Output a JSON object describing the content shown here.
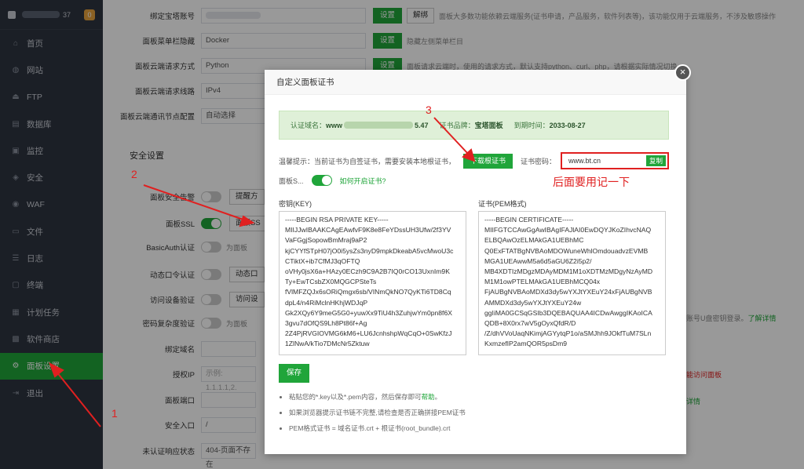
{
  "sidebar": {
    "account_suffix": "37",
    "badge": "0",
    "items": [
      {
        "label": "首页",
        "icon": "home-icon",
        "glyph": "⌂"
      },
      {
        "label": "网站",
        "icon": "globe-icon",
        "glyph": "◍"
      },
      {
        "label": "FTP",
        "icon": "ftp-icon",
        "glyph": "⏏"
      },
      {
        "label": "数据库",
        "icon": "database-icon",
        "glyph": "▤"
      },
      {
        "label": "监控",
        "icon": "monitor-icon",
        "glyph": "▣"
      },
      {
        "label": "安全",
        "icon": "shield-icon",
        "glyph": "◈"
      },
      {
        "label": "WAF",
        "icon": "waf-icon",
        "glyph": "◉"
      },
      {
        "label": "文件",
        "icon": "folder-icon",
        "glyph": "▭"
      },
      {
        "label": "日志",
        "icon": "log-icon",
        "glyph": "☰"
      },
      {
        "label": "终端",
        "icon": "terminal-icon",
        "glyph": "▢"
      },
      {
        "label": "计划任务",
        "icon": "calendar-icon",
        "glyph": "▦"
      },
      {
        "label": "软件商店",
        "icon": "apps-icon",
        "glyph": "▩"
      },
      {
        "label": "面板设置",
        "icon": "gear-icon",
        "glyph": "⚙"
      },
      {
        "label": "退出",
        "icon": "logout-icon",
        "glyph": "⇥"
      }
    ]
  },
  "settings": {
    "bind_account_label": "绑定宝塔账号",
    "set_btn": "设置",
    "unbind_btn": "解绑",
    "bind_account_desc": "面板大多数功能依赖云端服务(证书申请，产品服务，软件列表等)，该功能仅用于云端服务，不涉及敏感操作",
    "menu_hide_label": "面板菜单栏隐藏",
    "menu_hide_value": "Docker",
    "menu_hide_desc": "隐藏左侧菜单栏目",
    "cloud_method_label": "面板云端请求方式",
    "cloud_method_value": "Python",
    "cloud_method_desc": "面板请求云端时，使用的请求方式，默认支持python、curl、php，请根据实际情况切换",
    "cloud_line_label": "面板云端请求线路",
    "cloud_line_value": "IPv4",
    "cloud_node_label": "面板云端通讯节点配置",
    "cloud_node_value": "自动选择",
    "section_title": "安全设置",
    "security_alarm_label": "面板安全告警",
    "security_alarm_btn": "提醒方",
    "ssl_label": "面板SSL",
    "ssl_btn": "面板SS",
    "basic_auth_label": "BasicAuth认证",
    "basic_auth_desc": "为面板",
    "dynamic_auth_label": "动态口令认证",
    "dynamic_auth_btn": "动态口",
    "device_verify_label": "访问设备验证",
    "device_verify_btn": "访问设",
    "device_verify_desc": "账号U盘密钥登录。",
    "device_verify_link": "了解详情",
    "pwd_complex_label": "密码复杂度验证",
    "pwd_complex_desc": "为面板",
    "bind_domain_label": "绑定域名",
    "auth_ip_label": "授权IP",
    "auth_ip_placeholder": "示例: 1.1.1.1,2.",
    "auth_ip_desc": "能访问面板",
    "panel_port_label": "面板端口",
    "panel_port_desc": "详情",
    "entry_label": "安全入口",
    "entry_value": "/",
    "unauth_label": "未认证响应状态",
    "unauth_value": "404-页面不存在"
  },
  "modal": {
    "title": "自定义面板证书",
    "close": "×",
    "info": {
      "domain_label": "认证域名：",
      "domain_prefix": "www",
      "domain_suffix": "5.47",
      "brand_label": "证书品牌：",
      "brand_value": "宝塔面板",
      "expire_label": "到期时间：",
      "expire_value": "2033-08-27"
    },
    "tip_text": "温馨提示：当前证书为自签证书，需要安装本地根证书，",
    "download_btn": "下载根证书",
    "password_label": "证书密码：",
    "password_value": "www.bt.cn",
    "copy_btn": "复制",
    "ssl_label": "面板S...",
    "ssl_link": "如何开启证书?",
    "key_label": "密钥(KEY)",
    "cert_label": "证书(PEM格式)",
    "key_lines": [
      "-----BEGIN RSA PRIVATE KEY-----",
      "MIIJJwIBAAKCAgEAwfvF9K8e8FeYDssUH3Ufw/2f3YV",
      "VaFGgjSopowBmMraj9aP2",
      "kjCYYfSTpH07jO0i5ysZs3nyD9mpkDkeabA5vcMwoU3c",
      "CTiktX+ib7CfMJ3qOFTQ",
      "oVHy0jsX6a+HAzy0ECzh9C9A2B7IQ0rCO13UxnIm9K",
      "Ty+EwTCsbZX0MQGCPSteTs",
      "fVlMFZQJx6sORiQmgx6sb/VINmQkNO7QyKTi6TD8Cq",
      "dpL4/n4RiMclnHKhjWDJqP",
      "Gk2XQy6Y9meG5G0+yuwXx9TiU4h3ZuhjwYm0pn8f6X",
      "3gvu7dOfQS9Lh8Pt86f+Ag",
      "2Z4PjRVGIOVMG6kM6+LU6JcnhshpWqCqO+0SwKfzJ",
      "1ZlNwA/kTio7DMcNr5Zktuw"
    ],
    "cert_lines": [
      "-----BEGIN CERTIFICATE-----",
      "MIIFGTCCAwGgAwIBAgIFAJlAI0EwDQYJKoZIhvcNAQ",
      "ELBQAwOzELMAkGA1UEBhMC",
      "Q0ExFTATBgNVBAoMDOWuneWhlOmdouadvzEVMB",
      "MGA1UEAwwM5a6d5aGU6Z2i5p2/",
      "MB4XDTIzMDgzMDAyMDM1M1oXDTMzMDgyNzAyMD",
      "M1M1owPTELMAkGA1UEBhMCQ04x",
      "FjAUBgNVBAoMDXd3dy5wYXJtYXEuY24xFjAUBgNVB",
      "AMMDXd3dy5wYXJtYXEuY24w",
      "ggIiMA0GCSqGSIb3DQEBAQUAA4ICDwAwggIKAoICA",
      "QDB+8X0rx7wV5gOyxQfdR/D",
      "/Z/dhVVoUaqNKimjAGYytqP1o/aSMJhh9JOkfTuM7SLn",
      "KxmzefIP2amQOR5psDm9"
    ],
    "save_btn": "保存",
    "note1_pre": "粘贴您的*.key以及*.pem内容，然后保存即可",
    "note1_link": "帮助",
    "note1_post": "。",
    "note2": "如果浏览器提示证书链不完整,请检查是否正确拼接PEM证书",
    "note3": "PEM格式证书 = 域名证书.crt + 根证书(root_bundle).crt"
  },
  "annotations": {
    "num1": "1",
    "num2": "2",
    "num3": "3",
    "remember_note": "后面要用记一下"
  },
  "colors": {
    "accent": "#20a53a",
    "annotation": "#e02020",
    "sidebar_bg": "#2e3440"
  }
}
